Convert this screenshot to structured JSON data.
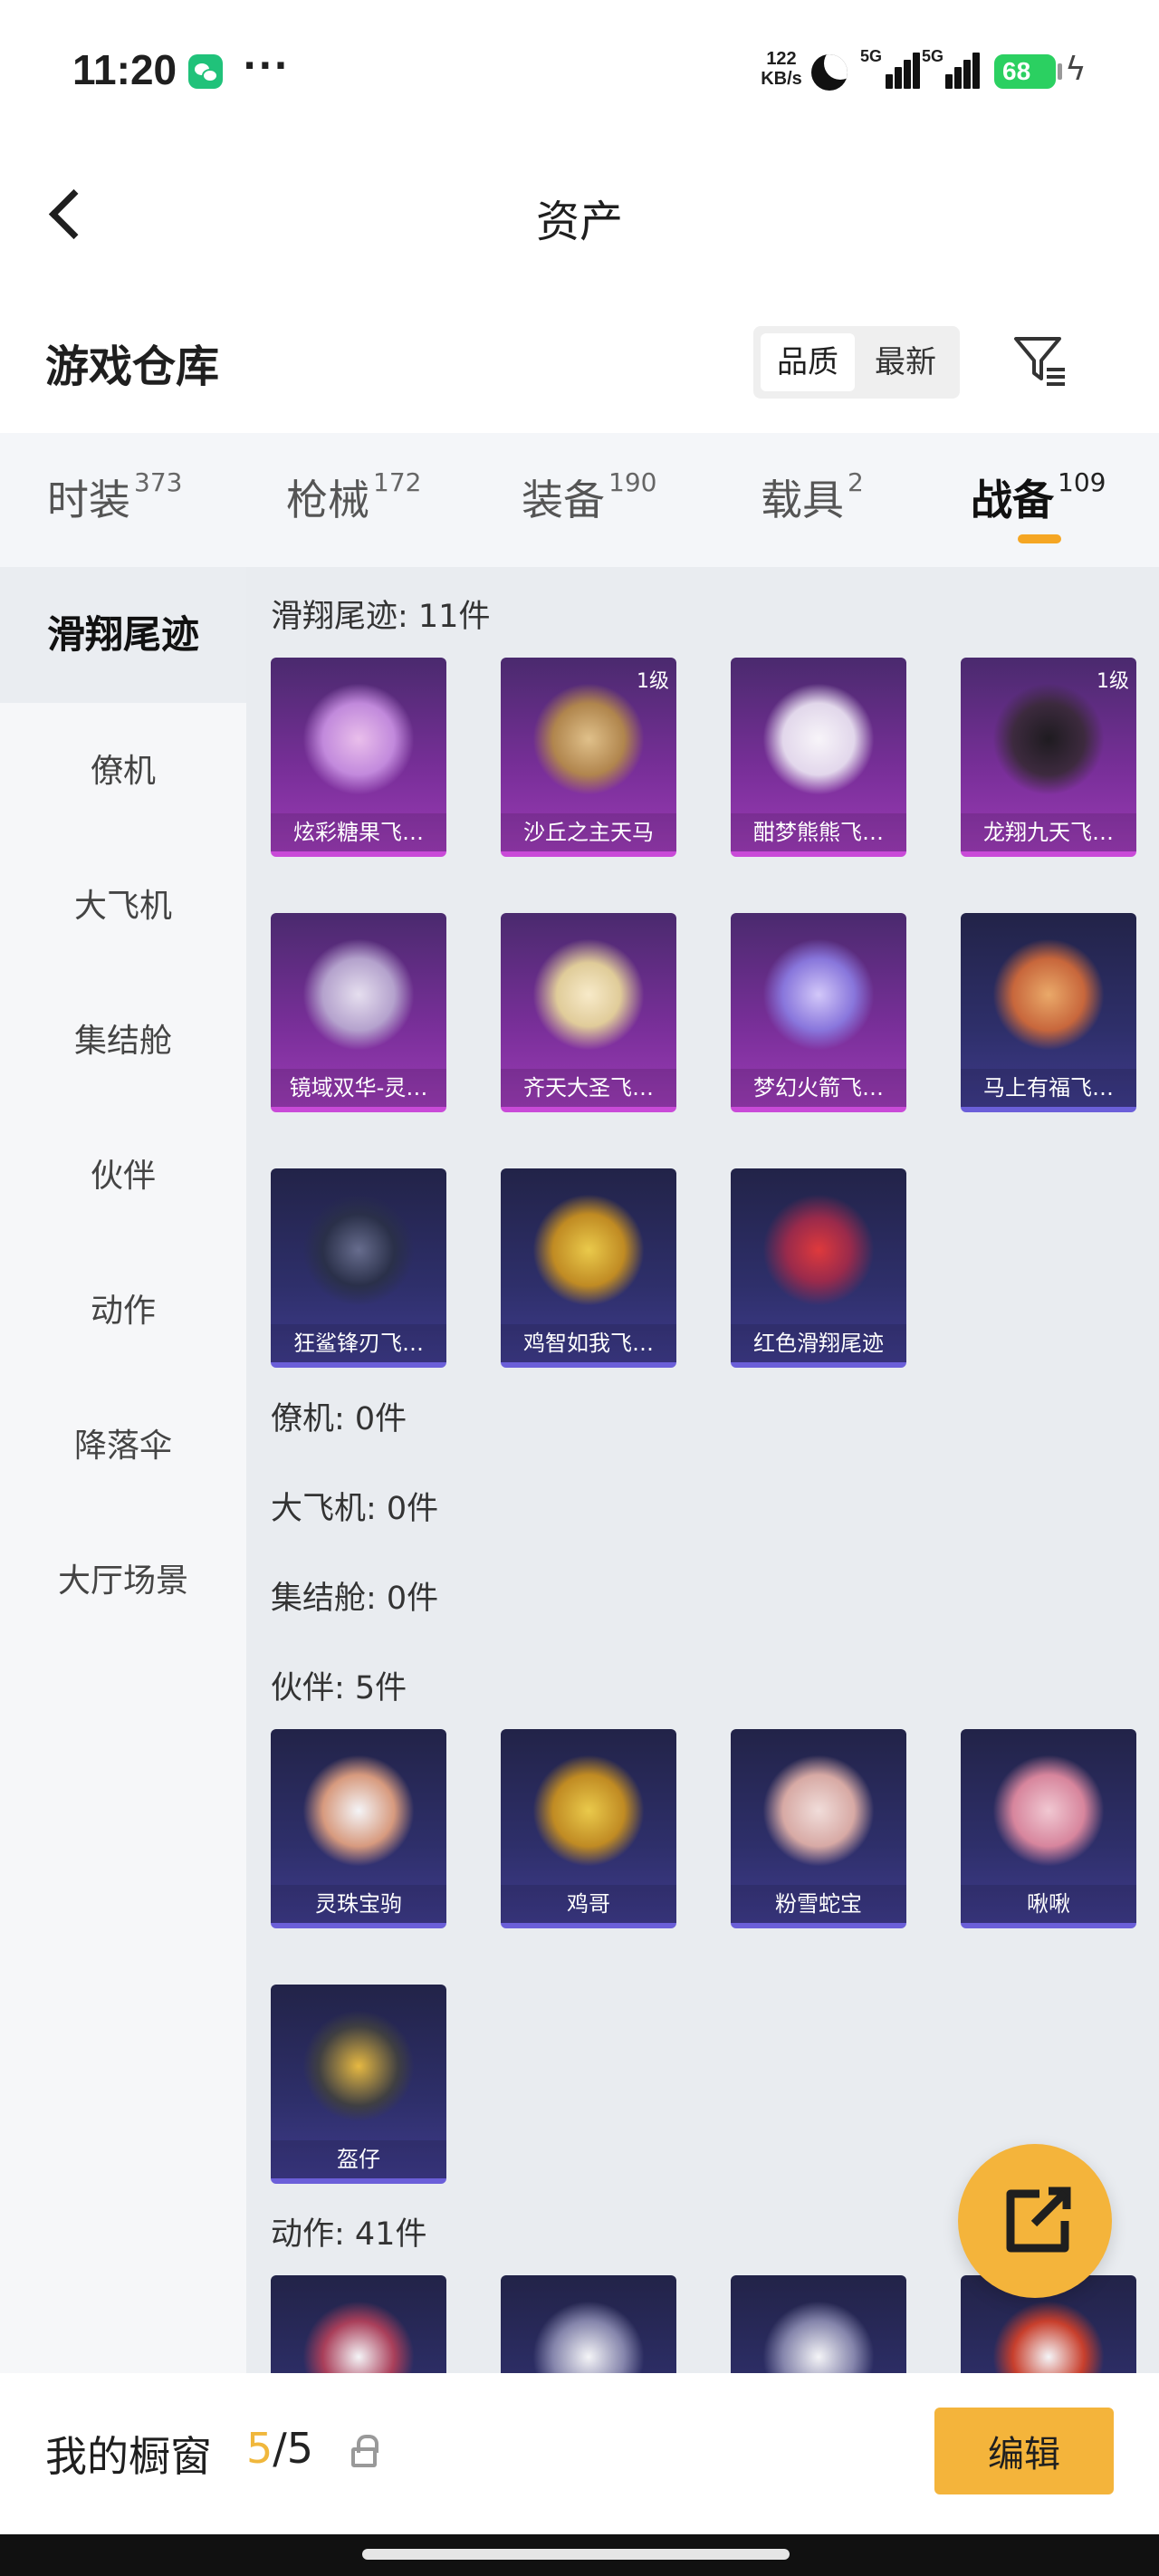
{
  "status_bar": {
    "time": "11:20",
    "more": "···",
    "net_speed": "122",
    "net_unit": "KB/s",
    "signal_1": "5G",
    "signal_2": "5G",
    "battery": "68"
  },
  "header": {
    "title": "资产"
  },
  "warehouse": {
    "title": "游戏仓库",
    "sort_quality": "品质",
    "sort_newest": "最新"
  },
  "tabs": [
    {
      "label": "时装",
      "count": "373"
    },
    {
      "label": "枪械",
      "count": "172"
    },
    {
      "label": "装备",
      "count": "190"
    },
    {
      "label": "载具",
      "count": "2"
    },
    {
      "label": "战备",
      "count": "109"
    }
  ],
  "sidebar": [
    "滑翔尾迹",
    "僚机",
    "大飞机",
    "集结舱",
    "伙伴",
    "动作",
    "降落伞",
    "大厅场景"
  ],
  "sections": {
    "glide": {
      "label": "滑翔尾迹: 11件",
      "items": [
        {
          "name": "炫彩糖果飞…",
          "level": ""
        },
        {
          "name": "沙丘之主天马",
          "level": "1级"
        },
        {
          "name": "酣梦熊熊飞…",
          "level": ""
        },
        {
          "name": "龙翔九天飞…",
          "level": "1级"
        },
        {
          "name": "镜域双华-灵…",
          "level": ""
        },
        {
          "name": "齐天大圣飞…",
          "level": ""
        },
        {
          "name": "梦幻火箭飞…",
          "level": ""
        },
        {
          "name": "马上有福飞…",
          "level": ""
        },
        {
          "name": "狂鲨锋刃飞…",
          "level": ""
        },
        {
          "name": "鸡智如我飞…",
          "level": ""
        },
        {
          "name": "红色滑翔尾迹",
          "level": ""
        }
      ]
    },
    "wingman": {
      "label": "僚机: 0件"
    },
    "plane": {
      "label": "大飞机: 0件"
    },
    "pod": {
      "label": "集结舱: 0件"
    },
    "partner": {
      "label": "伙伴: 5件",
      "items": [
        {
          "name": "灵珠宝驹"
        },
        {
          "name": "鸡哥"
        },
        {
          "name": "粉雪蛇宝"
        },
        {
          "name": "啾啾"
        },
        {
          "name": "盔仔"
        }
      ]
    },
    "action": {
      "label": "动作: 41件"
    }
  },
  "bottom_bar": {
    "showcase_label": "我的橱窗",
    "showcase_current": "5",
    "showcase_total": "/5",
    "edit_label": "编辑"
  },
  "colors": {
    "accent": "#f4b43b",
    "purple_card": "#7a2f9a",
    "blue_card": "#2e2f6a"
  }
}
